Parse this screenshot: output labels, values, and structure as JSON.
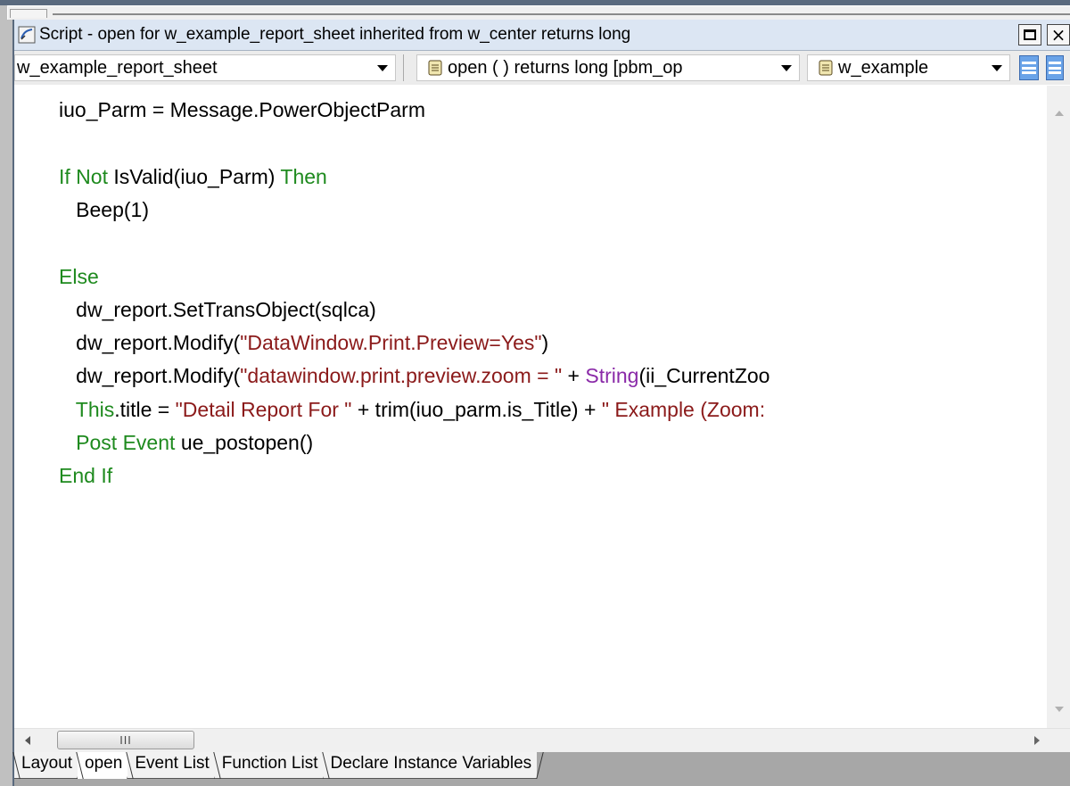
{
  "window": {
    "title": "Script - open for w_example_report_sheet inherited from w_center returns long",
    "restore_icon": "restore-icon",
    "close_label": "×"
  },
  "toolbar": {
    "object_select": "w_example_report_sheet",
    "event_select": "open ( )  returns long [pbm_op",
    "ancestor_select": "w_example"
  },
  "code": {
    "lines": [
      [
        {
          "t": "iuo_Parm = Message.PowerObjectParm",
          "c": ""
        }
      ],
      [],
      [
        {
          "t": "If ",
          "c": "kw"
        },
        {
          "t": "Not ",
          "c": "kw"
        },
        {
          "t": "IsValid(iuo_Parm) ",
          "c": ""
        },
        {
          "t": "Then",
          "c": "kw"
        }
      ],
      [
        {
          "t": "   Beep(1)",
          "c": ""
        }
      ],
      [],
      [
        {
          "t": "Else",
          "c": "kw"
        }
      ],
      [
        {
          "t": "   dw_report.SetTransObject(sqlca)",
          "c": ""
        }
      ],
      [
        {
          "t": "   dw_report.Modify(",
          "c": ""
        },
        {
          "t": "\"DataWindow.Print.Preview=Yes\"",
          "c": "str"
        },
        {
          "t": ")",
          "c": ""
        }
      ],
      [
        {
          "t": "   dw_report.Modify(",
          "c": ""
        },
        {
          "t": "\"datawindow.print.preview.zoom = \"",
          "c": "str"
        },
        {
          "t": " + ",
          "c": ""
        },
        {
          "t": "String",
          "c": "fn"
        },
        {
          "t": "(ii_CurrentZoo",
          "c": ""
        }
      ],
      [
        {
          "t": "   ",
          "c": ""
        },
        {
          "t": "This",
          "c": "kw"
        },
        {
          "t": ".title = ",
          "c": ""
        },
        {
          "t": "\"Detail Report For \"",
          "c": "str"
        },
        {
          "t": " + trim(iuo_parm.is_Title) + ",
          "c": ""
        },
        {
          "t": "\" Example (Zoom:",
          "c": "str"
        }
      ],
      [
        {
          "t": "   ",
          "c": ""
        },
        {
          "t": "Post ",
          "c": "kw"
        },
        {
          "t": "Event ",
          "c": "kw"
        },
        {
          "t": "ue_postopen()",
          "c": ""
        }
      ],
      [
        {
          "t": "End If",
          "c": "kw"
        }
      ]
    ]
  },
  "hscroll": {
    "thumb_grip": "III"
  },
  "tabs": [
    {
      "label": "Layout",
      "active": false
    },
    {
      "label": "open",
      "active": true
    },
    {
      "label": "Event List",
      "active": false
    },
    {
      "label": "Function List",
      "active": false
    },
    {
      "label": "Declare Instance Variables",
      "active": false
    }
  ],
  "colors": {
    "keyword": "#1e8a1e",
    "string": "#8b1a1a",
    "function": "#8a2aa8",
    "titlebar": "#dce6f3"
  }
}
